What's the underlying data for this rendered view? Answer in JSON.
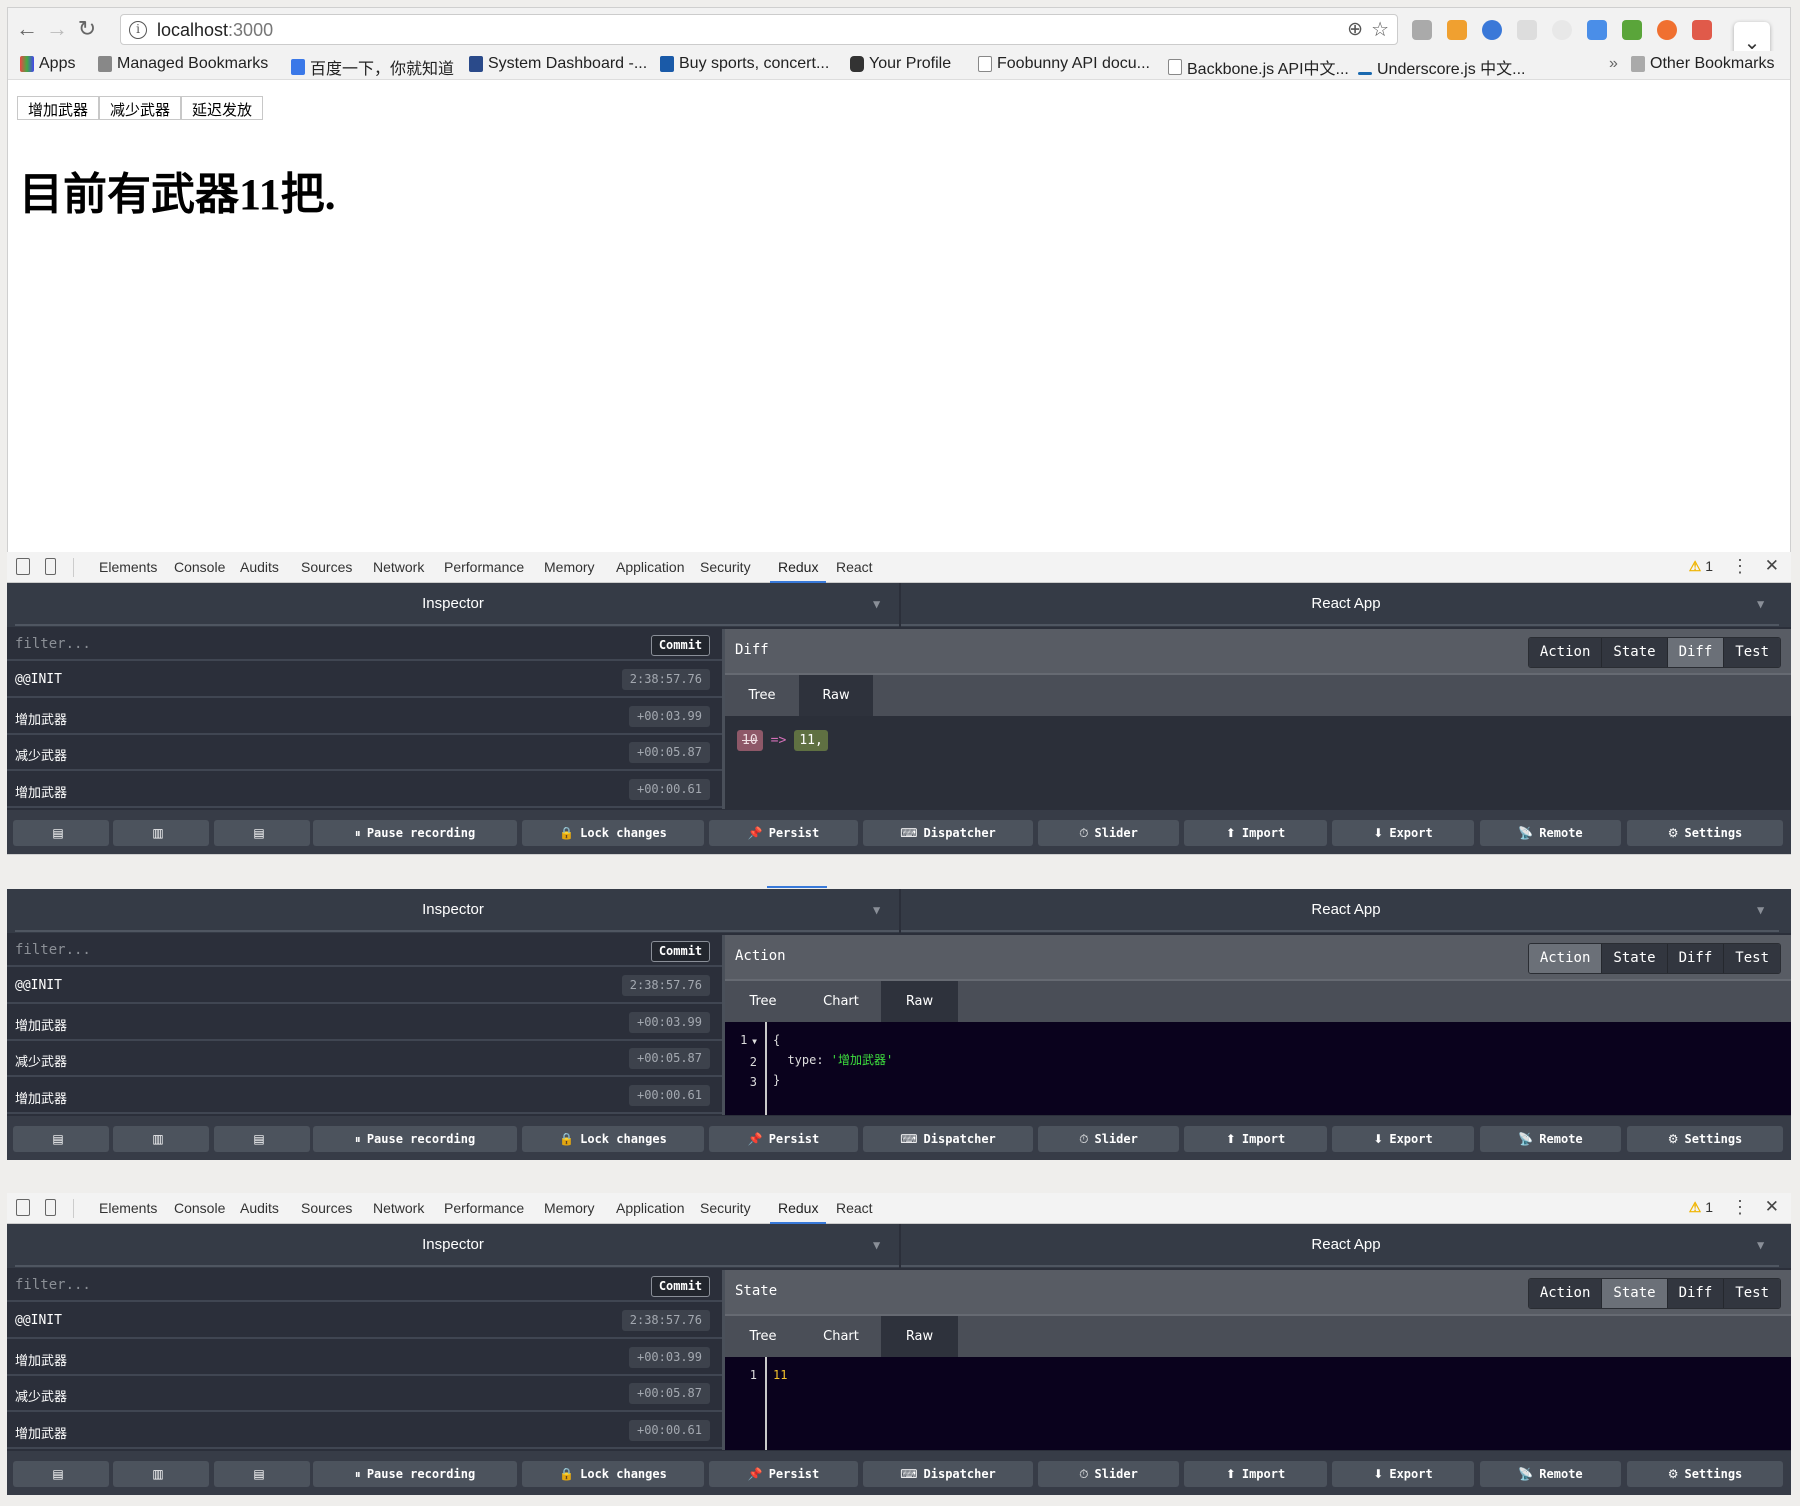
{
  "browser": {
    "url_host": "localhost",
    "url_port": ":3000",
    "bookmarks": [
      "Apps",
      "Managed Bookmarks",
      "百度一下，你就知道",
      "System Dashboard -...",
      "Buy sports, concert...",
      "Your Profile",
      "Foobunny API docu...",
      "Backbone.js API中文...",
      "Underscore.js 中文..."
    ],
    "overflow": "»",
    "other_bookmarks": "Other Bookmarks"
  },
  "page": {
    "buttons": [
      "增加武器",
      "减少武器",
      "延迟发放"
    ],
    "heading": "目前有武器11把."
  },
  "devtools": {
    "tabs": [
      "Elements",
      "Console",
      "Audits",
      "Sources",
      "Network",
      "Performance",
      "Memory",
      "Application",
      "Security",
      "Redux",
      "React"
    ],
    "selected_tab": "Redux",
    "warning_count": "1"
  },
  "inspector": {
    "left_title": "Inspector",
    "right_title": "React App",
    "filter_placeholder": "filter...",
    "commit_label": "Commit",
    "actions": [
      {
        "name": "@@INIT",
        "time": "2:38:57.76"
      },
      {
        "name": "增加武器",
        "time": "+00:03.99"
      },
      {
        "name": "减少武器",
        "time": "+00:05.87"
      },
      {
        "name": "增加武器",
        "time": "+00:00.61"
      }
    ],
    "monitor_tabs": [
      "Action",
      "State",
      "Diff",
      "Test"
    ],
    "buttons": [
      {
        "icon": "layout-left-icon",
        "glyph": "▤",
        "label": ""
      },
      {
        "icon": "layout-bottom-icon",
        "glyph": "▥",
        "label": ""
      },
      {
        "icon": "layout-right-icon",
        "glyph": "▤",
        "label": ""
      },
      {
        "icon": "pause-icon",
        "glyph": "⏸",
        "label": "Pause recording"
      },
      {
        "icon": "lock-icon",
        "glyph": "🔒",
        "label": "Lock changes"
      },
      {
        "icon": "pin-icon",
        "glyph": "📌",
        "label": "Persist"
      },
      {
        "icon": "keyboard-icon",
        "glyph": "⌨",
        "label": "Dispatcher"
      },
      {
        "icon": "stopwatch-icon",
        "glyph": "⏱",
        "label": "Slider"
      },
      {
        "icon": "upload-icon",
        "glyph": "⬆",
        "label": "Import"
      },
      {
        "icon": "download-icon",
        "glyph": "⬇",
        "label": "Export"
      },
      {
        "icon": "antenna-icon",
        "glyph": "📡",
        "label": "Remote"
      },
      {
        "icon": "gear-icon",
        "glyph": "⚙",
        "label": "Settings"
      }
    ]
  },
  "panels": [
    {
      "section": "Diff",
      "selected_monitor": "Diff",
      "subtabs": [
        "Tree",
        "Raw"
      ],
      "selected_subtab": "Raw",
      "diff": {
        "old": "10",
        "arrow": "=>",
        "new": "11,"
      }
    },
    {
      "section": "Action",
      "selected_monitor": "Action",
      "subtabs": [
        "Tree",
        "Chart",
        "Raw"
      ],
      "selected_subtab": "Raw",
      "code": {
        "lines": [
          "1",
          "2",
          "3"
        ],
        "open": "{",
        "key": "  type: ",
        "value": "'增加武器'",
        "close": "}"
      }
    },
    {
      "section": "State",
      "selected_monitor": "State",
      "subtabs": [
        "Tree",
        "Chart",
        "Raw"
      ],
      "selected_subtab": "Raw",
      "code": {
        "lines": [
          "1"
        ],
        "value": "11"
      }
    }
  ]
}
